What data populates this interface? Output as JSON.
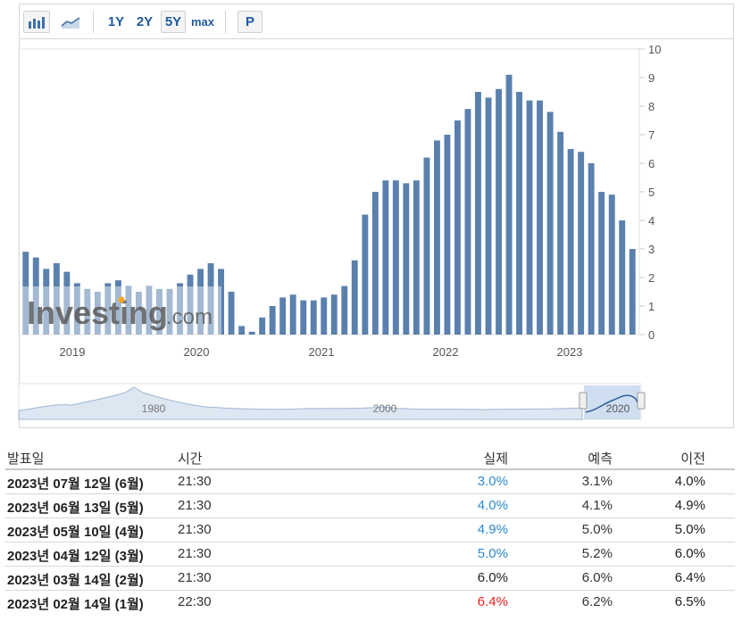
{
  "toolbar": {
    "bar_chart_icon": "bar-chart-icon",
    "line_chart_icon": "line-chart-icon",
    "ranges": [
      "1Y",
      "2Y",
      "5Y",
      "max"
    ],
    "selected_range": "5Y",
    "p_label": "P"
  },
  "watermark": {
    "brand": "Investing",
    "suffix": ".com"
  },
  "chart_data": {
    "type": "bar",
    "ylim": [
      0,
      10
    ],
    "y_ticks": [
      "0",
      "1",
      "2",
      "3",
      "4",
      "5",
      "6",
      "7",
      "8",
      "9",
      "10"
    ],
    "x_labels": [
      "2019",
      "2020",
      "2021",
      "2022",
      "2023"
    ],
    "navigator_labels": [
      "1980",
      "2000",
      "2020"
    ],
    "bar_color": "#5a80ad",
    "values": [
      2.9,
      2.7,
      2.3,
      2.5,
      2.2,
      1.8,
      1.6,
      1.5,
      1.8,
      1.9,
      1.7,
      1.5,
      1.7,
      1.6,
      1.6,
      1.8,
      2.1,
      2.3,
      2.5,
      2.3,
      1.5,
      0.3,
      0.1,
      0.6,
      1.0,
      1.3,
      1.4,
      1.2,
      1.2,
      1.3,
      1.4,
      1.7,
      2.6,
      4.2,
      5.0,
      5.4,
      5.4,
      5.3,
      5.4,
      6.2,
      6.8,
      7.0,
      7.5,
      7.9,
      8.5,
      8.3,
      8.6,
      9.1,
      8.5,
      8.2,
      8.2,
      7.8,
      7.1,
      6.5,
      6.4,
      6.0,
      5.0,
      4.9,
      4.0,
      3.0
    ]
  },
  "table": {
    "headers": {
      "date": "발표일",
      "time": "시간",
      "actual": "실제",
      "forecast": "예측",
      "previous": "이전"
    },
    "rows": [
      {
        "date": "2023년 07월 12일 (6월)",
        "time": "21:30",
        "actual": "3.0%",
        "actual_state": "up",
        "forecast": "3.1%",
        "previous": "4.0%"
      },
      {
        "date": "2023년 06월 13일 (5월)",
        "time": "21:30",
        "actual": "4.0%",
        "actual_state": "up",
        "forecast": "4.1%",
        "previous": "4.9%"
      },
      {
        "date": "2023년 05월 10일 (4월)",
        "time": "21:30",
        "actual": "4.9%",
        "actual_state": "up",
        "forecast": "5.0%",
        "previous": "5.0%"
      },
      {
        "date": "2023년 04월 12일 (3월)",
        "time": "21:30",
        "actual": "5.0%",
        "actual_state": "up",
        "forecast": "5.2%",
        "previous": "6.0%"
      },
      {
        "date": "2023년 03월 14일 (2월)",
        "time": "21:30",
        "actual": "6.0%",
        "actual_state": "neutral",
        "forecast": "6.0%",
        "previous": "6.4%"
      },
      {
        "date": "2023년 02월 14일 (1월)",
        "time": "22:30",
        "actual": "6.4%",
        "actual_state": "down",
        "forecast": "6.2%",
        "previous": "6.5%"
      }
    ]
  }
}
